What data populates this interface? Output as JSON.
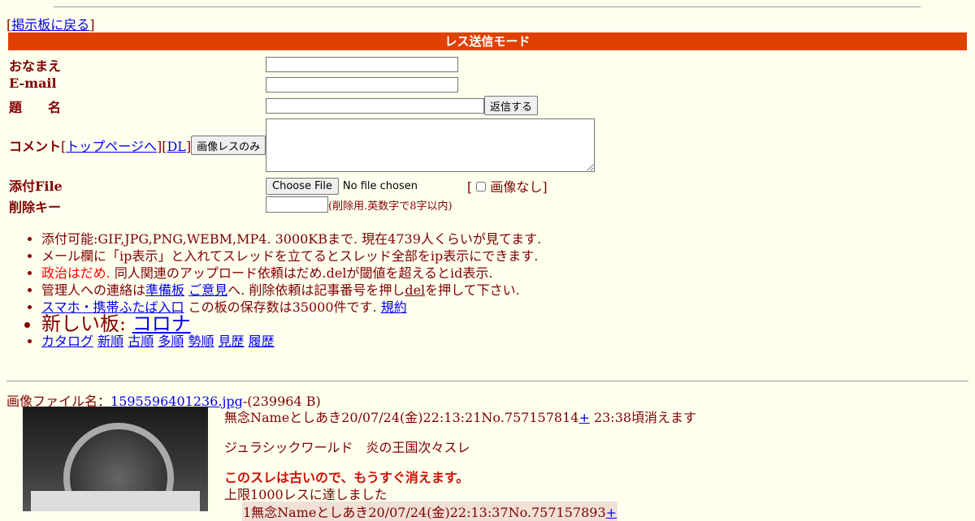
{
  "nav": {
    "back_link": "掲示板に戻る"
  },
  "mode_title": "レス送信モード",
  "form": {
    "name_label": "おなまえ",
    "email_label": "E-mail",
    "subject_label": "題　　名",
    "submit_label": "返信する",
    "comment_label": "コメント",
    "top_link": "トップページへ",
    "dl_link": "DL",
    "image_only_button": "画像レスのみ",
    "file_label": "添付File",
    "choose_file_button": "Choose File",
    "no_file_text": "No file chosen",
    "no_image_label": "画像なし",
    "delete_key_label": "削除キー",
    "delete_key_hint": "(削除用.英数字で8字以内)"
  },
  "rules": {
    "r1": "添付可能:GIF,JPG,PNG,WEBM,MP4. 3000KBまで. 現在4739人くらいが見てます.",
    "r2": "メール欄に「ip表示」と入れてスレッドを立てるとスレッド全部をip表示にできます.",
    "r3_red": "政治はだめ.",
    "r3_rest": " 同人関連のアップロード依頼はだめ.delが閾値を超えるとid表示.",
    "r4_pre": "管理人への連絡は",
    "r4_link1": "準備板",
    "r4_link2": "ご意見",
    "r4_post": "へ. 削除依頼は記事番号を押し",
    "r4_del": "del",
    "r4_end": "を押して下さい.",
    "r5_link": "スマホ・携帯ふたば入口",
    "r5_text": " この板の保存数は35000件です. ",
    "r5_rules_link": "規約",
    "r6_text": "新しい板: ",
    "r6_link": "コロナ",
    "r7": [
      "カタログ",
      "新順",
      "古順",
      "多順",
      "勢順",
      "見歴",
      "履歴"
    ]
  },
  "thread": {
    "image_file_label": "画像ファイル名：",
    "image_file_link": "1595596401236.jpg",
    "image_size": "-(239964 B)",
    "header_text": "無念Nameとしあき20/07/24(金)22:13:21No.757157814",
    "plus": "+",
    "expire": " 23:38頃消えます",
    "title": "ジュラシックワールド　炎の王国次々スレ",
    "warning": "このスレは古いので、もうすぐ消えます。",
    "limit": "上限1000レスに達しました",
    "reply_header": "1無念Nameとしあき20/07/24(金)22:13:37No.757157893",
    "reply_plus": "+"
  },
  "colors": {
    "mode_bar": "#e04000",
    "background": "#ffffee",
    "text": "#800000",
    "warning": "#cc1105"
  }
}
